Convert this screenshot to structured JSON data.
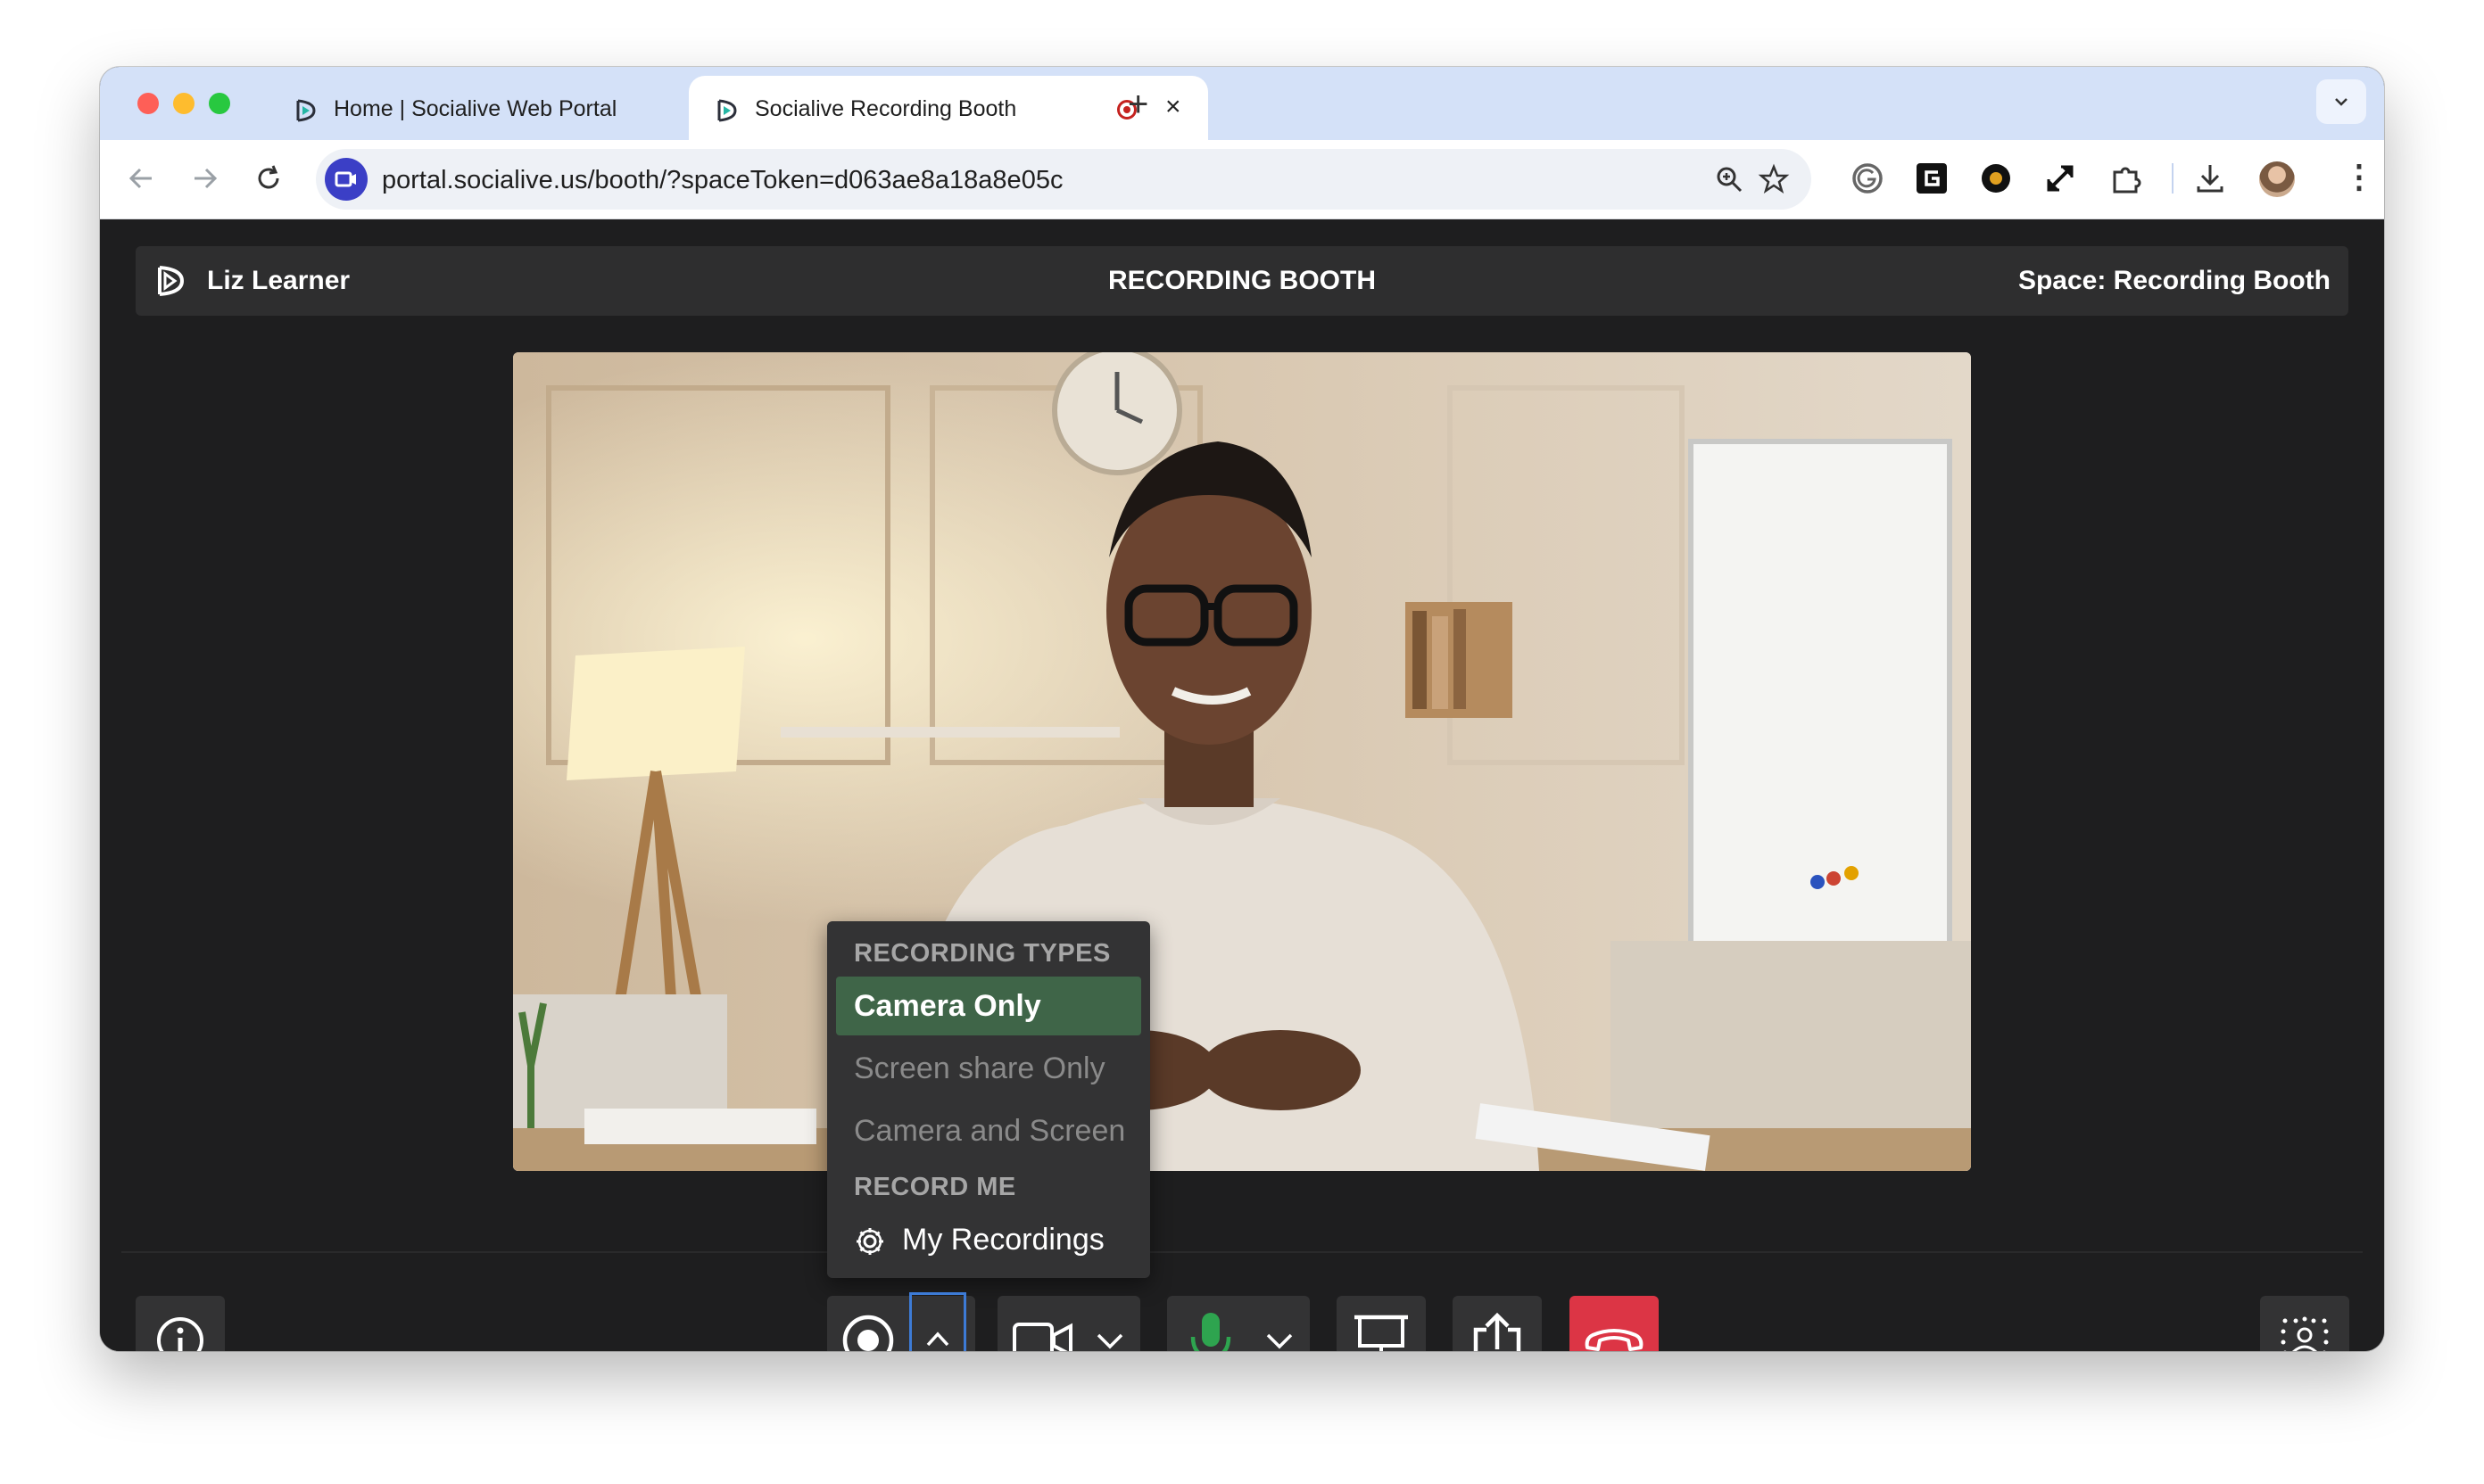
{
  "browser": {
    "tabs": [
      {
        "title": "Home | Socialive Web Portal",
        "active": false
      },
      {
        "title": "Socialive Recording Booth",
        "active": true,
        "recording": true
      }
    ],
    "new_tab_label": "+",
    "url": "portal.socialive.us/booth/?spaceToken=d063ae8a18a8e05c",
    "icons": [
      "back-arrow-icon",
      "forward-arrow-icon",
      "reload-icon",
      "zoom-icon",
      "star-icon",
      "grammarly-icon",
      "extension-g-icon",
      "extension-info-icon",
      "fullscreen-icon",
      "puzzle-icon",
      "download-icon",
      "avatar",
      "more-icon"
    ]
  },
  "app": {
    "user_name": "Liz Learner",
    "page_title": "RECORDING BOOTH",
    "space_label": "Space: Recording Booth"
  },
  "recording_menu": {
    "section1_heading": "RECORDING TYPES",
    "options": [
      {
        "label": "Camera Only",
        "selected": true
      },
      {
        "label": "Screen share Only",
        "enabled": false
      },
      {
        "label": "Camera and Screen",
        "enabled": false
      }
    ],
    "section2_heading": "RECORD ME",
    "my_recordings_label": "My Recordings"
  },
  "controls": [
    "info-icon",
    "record-icon",
    "chevron-up-icon",
    "camera-icon",
    "chevron-down-icon",
    "microphone-icon",
    "chevron-down-icon",
    "present-icon",
    "share-icon",
    "end-call-icon",
    "background-effects-icon"
  ],
  "colors": {
    "accent_selected": "#3f6548",
    "leave_red": "#dc3545",
    "mic_green": "#2ea44f",
    "focus_blue": "#3d7bd6"
  }
}
